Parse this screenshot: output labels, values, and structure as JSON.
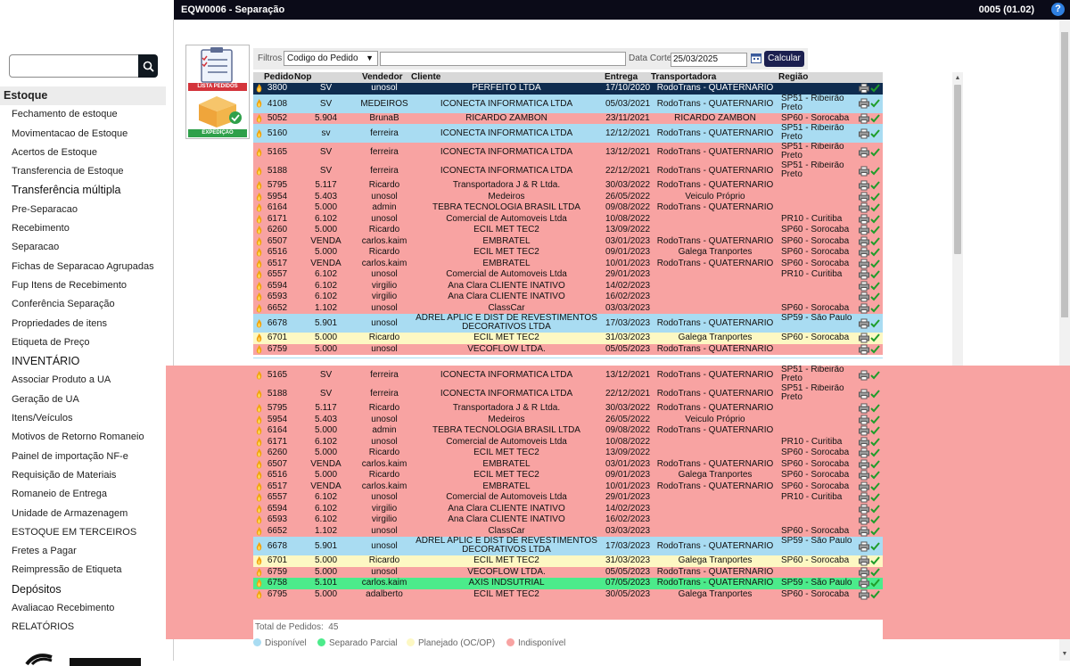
{
  "window": {
    "title": "EQW0006 - Separação",
    "version": "0005 (01.02)",
    "help_label": "?"
  },
  "sidebar": {
    "search_placeholder": "",
    "items": [
      {
        "label": "Estoque",
        "kind": "active"
      },
      {
        "label": "Fechamento de estoque",
        "kind": "item"
      },
      {
        "label": "Movimentacao de Estoque",
        "kind": "item"
      },
      {
        "label": "Acertos de Estoque",
        "kind": "item"
      },
      {
        "label": "Transferencia de Estoque",
        "kind": "item"
      },
      {
        "label": "Transferência múltipla",
        "kind": "section"
      },
      {
        "label": "Pre-Separacao",
        "kind": "item"
      },
      {
        "label": "Recebimento",
        "kind": "item"
      },
      {
        "label": "Separacao",
        "kind": "item"
      },
      {
        "label": "Fichas de Separacao Agrupadas",
        "kind": "item"
      },
      {
        "label": "Fup Itens de Recebimento",
        "kind": "item"
      },
      {
        "label": "Conferência Separação",
        "kind": "item"
      },
      {
        "label": "Propriedades de itens",
        "kind": "item"
      },
      {
        "label": "Etiqueta de Preço",
        "kind": "item"
      },
      {
        "label": "INVENTÁRIO",
        "kind": "section"
      },
      {
        "label": "Associar Produto a UA",
        "kind": "item"
      },
      {
        "label": "Geração de UA",
        "kind": "item"
      },
      {
        "label": "Itens/Veículos",
        "kind": "item"
      },
      {
        "label": "Motivos de Retorno Romaneio",
        "kind": "item"
      },
      {
        "label": "Painel de importação NF-e",
        "kind": "item"
      },
      {
        "label": "Requisição de Materiais",
        "kind": "item"
      },
      {
        "label": "Romaneio de Entrega",
        "kind": "item"
      },
      {
        "label": "Unidade de Armazenagem",
        "kind": "item"
      },
      {
        "label": "ESTOQUE EM TERCEIROS",
        "kind": "item"
      },
      {
        "label": "Fretes a Pagar",
        "kind": "item"
      },
      {
        "label": "Reimpressão de Etiqueta",
        "kind": "item"
      },
      {
        "label": "Depósitos",
        "kind": "section"
      },
      {
        "label": "Avaliacao Recebimento",
        "kind": "item"
      },
      {
        "label": "RELATÓRIOS",
        "kind": "item"
      }
    ]
  },
  "logo": {
    "top_band": "LISTA PEDIDOS",
    "bottom_band": "EXPEDIÇÃO"
  },
  "filters": {
    "label": "Filtros",
    "select_value": "Codigo do Pedido",
    "search_value": "",
    "date_label": "Data Corte",
    "date_value": "25/03/2025",
    "calc_label": "Calcular"
  },
  "grid": {
    "columns": [
      "Pedido",
      "Nop",
      "Vendedor",
      "Cliente",
      "Entrega",
      "Transportadora",
      "Região"
    ],
    "status_colors": {
      "blue": "#a9dcf2",
      "pink": "#f8a3a2",
      "yellow": "#fdf8c3",
      "green": "#4ceb8b",
      "selected": "#0f2c4f"
    },
    "rows": [
      {
        "pedido": "3800",
        "nop": "SV",
        "vendedor": "unosol",
        "cliente": "PERFEITO LTDA",
        "entrega": "17/10/2020",
        "transp": "RodoTrans - QUATERNARIO",
        "regiao": "",
        "status": "selected"
      },
      {
        "pedido": "4108",
        "nop": "SV",
        "vendedor": "MEDEIROS",
        "cliente": "ICONECTA INFORMATICA LTDA",
        "entrega": "05/03/2021",
        "transp": "RodoTrans - QUATERNARIO",
        "regiao": "SP51 - Ribeirão Preto",
        "status": "blue"
      },
      {
        "pedido": "5052",
        "nop": "5.904",
        "vendedor": "BrunaB",
        "cliente": "RICARDO ZAMBON",
        "entrega": "23/11/2021",
        "transp": "RICARDO ZAMBON",
        "regiao": "SP60 - Sorocaba",
        "status": "pink"
      },
      {
        "pedido": "5160",
        "nop": "sv",
        "vendedor": "ferreira",
        "cliente": "ICONECTA INFORMATICA LTDA",
        "entrega": "12/12/2021",
        "transp": "RodoTrans - QUATERNARIO",
        "regiao": "SP51 - Ribeirão Preto",
        "status": "blue"
      },
      {
        "pedido": "5165",
        "nop": "SV",
        "vendedor": "ferreira",
        "cliente": "ICONECTA INFORMATICA LTDA",
        "entrega": "13/12/2021",
        "transp": "RodoTrans - QUATERNARIO",
        "regiao": "SP51 - Ribeirão Preto",
        "status": "pink"
      },
      {
        "pedido": "5188",
        "nop": "SV",
        "vendedor": "ferreira",
        "cliente": "ICONECTA INFORMATICA LTDA",
        "entrega": "22/12/2021",
        "transp": "RodoTrans - QUATERNARIO",
        "regiao": "SP51 - Ribeirão Preto",
        "status": "pink"
      },
      {
        "pedido": "5795",
        "nop": "5.117",
        "vendedor": "Ricardo",
        "cliente": "Transportadora J & R Ltda.",
        "entrega": "30/03/2022",
        "transp": "RodoTrans - QUATERNARIO",
        "regiao": "",
        "status": "pink"
      },
      {
        "pedido": "5954",
        "nop": "5.403",
        "vendedor": "unosol",
        "cliente": "Medeiros",
        "entrega": "26/05/2022",
        "transp": "Veiculo Próprio",
        "regiao": "",
        "status": "pink"
      },
      {
        "pedido": "6164",
        "nop": "5.000",
        "vendedor": "admin",
        "cliente": "TEBRA TECNOLOGIA BRASIL LTDA",
        "entrega": "09/08/2022",
        "transp": "RodoTrans - QUATERNARIO",
        "regiao": "",
        "status": "pink"
      },
      {
        "pedido": "6171",
        "nop": "6.102",
        "vendedor": "unosol",
        "cliente": "Comercial de Automoveis Ltda",
        "entrega": "10/08/2022",
        "transp": "",
        "regiao": "PR10 - Curitiba",
        "status": "pink"
      },
      {
        "pedido": "6260",
        "nop": "5.000",
        "vendedor": "Ricardo",
        "cliente": "ECIL MET TEC2",
        "entrega": "13/09/2022",
        "transp": "",
        "regiao": "SP60 - Sorocaba",
        "status": "pink"
      },
      {
        "pedido": "6507",
        "nop": "VENDA",
        "vendedor": "carlos.kaim",
        "cliente": "EMBRATEL",
        "entrega": "03/01/2023",
        "transp": "RodoTrans - QUATERNARIO",
        "regiao": "SP60 - Sorocaba",
        "status": "pink"
      },
      {
        "pedido": "6516",
        "nop": "5.000",
        "vendedor": "Ricardo",
        "cliente": "ECIL MET TEC2",
        "entrega": "09/01/2023",
        "transp": "Galega Tranportes",
        "regiao": "SP60 - Sorocaba",
        "status": "pink"
      },
      {
        "pedido": "6517",
        "nop": "VENDA",
        "vendedor": "carlos.kaim",
        "cliente": "EMBRATEL",
        "entrega": "10/01/2023",
        "transp": "RodoTrans - QUATERNARIO",
        "regiao": "SP60 - Sorocaba",
        "status": "pink"
      },
      {
        "pedido": "6557",
        "nop": "6.102",
        "vendedor": "unosol",
        "cliente": "Comercial de Automoveis Ltda",
        "entrega": "29/01/2023",
        "transp": "",
        "regiao": "PR10 - Curitiba",
        "status": "pink"
      },
      {
        "pedido": "6594",
        "nop": "6.102",
        "vendedor": "virgilio",
        "cliente": "Ana Clara CLIENTE INATIVO",
        "entrega": "14/02/2023",
        "transp": "",
        "regiao": "",
        "status": "pink"
      },
      {
        "pedido": "6593",
        "nop": "6.102",
        "vendedor": "virgilio",
        "cliente": "Ana Clara CLIENTE INATIVO",
        "entrega": "16/02/2023",
        "transp": "",
        "regiao": "",
        "status": "pink"
      },
      {
        "pedido": "6652",
        "nop": "1.102",
        "vendedor": "unosol",
        "cliente": "ClassCar",
        "entrega": "03/03/2023",
        "transp": "",
        "regiao": "SP60 - Sorocaba",
        "status": "pink"
      },
      {
        "pedido": "6678",
        "nop": "5.901",
        "vendedor": "unosol",
        "cliente": "ADREL APLIC E DIST DE REVESTIMENTOS DECORATIVOS LTDA",
        "entrega": "17/03/2023",
        "transp": "RodoTrans - QUATERNARIO",
        "regiao": "SP59 - São Paulo",
        "status": "blue"
      },
      {
        "pedido": "6701",
        "nop": "5.000",
        "vendedor": "Ricardo",
        "cliente": "ECIL MET TEC2",
        "entrega": "31/03/2023",
        "transp": "Galega Tranportes",
        "regiao": "SP60 - Sorocaba",
        "status": "yellow"
      },
      {
        "pedido": "6759",
        "nop": "5.000",
        "vendedor": "unosol",
        "cliente": "VECOFLOW LTDA.",
        "entrega": "05/05/2023",
        "transp": "RodoTrans - QUATERNARIO",
        "regiao": "",
        "status": "pink"
      }
    ],
    "dup_row": {
      "pedido": "5160",
      "nop": "sv",
      "vendedor": "ferreira",
      "cliente": "ICONECTA INFORMATICA LTDA",
      "entrega": "12/12/2021",
      "transp": "RodoTrans - QUATERNARIO",
      "regiao": "Preto",
      "status": "blue"
    },
    "rows_b": [
      {
        "pedido": "5165",
        "nop": "SV",
        "vendedor": "ferreira",
        "cliente": "ICONECTA INFORMATICA LTDA",
        "entrega": "13/12/2021",
        "transp": "RodoTrans - QUATERNARIO",
        "regiao": "SP51 - Ribeirão Preto",
        "status": "pink"
      },
      {
        "pedido": "5188",
        "nop": "SV",
        "vendedor": "ferreira",
        "cliente": "ICONECTA INFORMATICA LTDA",
        "entrega": "22/12/2021",
        "transp": "RodoTrans - QUATERNARIO",
        "regiao": "SP51 - Ribeirão Preto",
        "status": "pink"
      },
      {
        "pedido": "5795",
        "nop": "5.117",
        "vendedor": "Ricardo",
        "cliente": "Transportadora J & R Ltda.",
        "entrega": "30/03/2022",
        "transp": "RodoTrans - QUATERNARIO",
        "regiao": "",
        "status": "pink"
      },
      {
        "pedido": "5954",
        "nop": "5.403",
        "vendedor": "unosol",
        "cliente": "Medeiros",
        "entrega": "26/05/2022",
        "transp": "Veiculo Próprio",
        "regiao": "",
        "status": "pink"
      },
      {
        "pedido": "6164",
        "nop": "5.000",
        "vendedor": "admin",
        "cliente": "TEBRA TECNOLOGIA BRASIL LTDA",
        "entrega": "09/08/2022",
        "transp": "RodoTrans - QUATERNARIO",
        "regiao": "",
        "status": "pink"
      },
      {
        "pedido": "6171",
        "nop": "6.102",
        "vendedor": "unosol",
        "cliente": "Comercial de Automoveis Ltda",
        "entrega": "10/08/2022",
        "transp": "",
        "regiao": "PR10 - Curitiba",
        "status": "pink"
      },
      {
        "pedido": "6260",
        "nop": "5.000",
        "vendedor": "Ricardo",
        "cliente": "ECIL MET TEC2",
        "entrega": "13/09/2022",
        "transp": "",
        "regiao": "SP60 - Sorocaba",
        "status": "pink"
      },
      {
        "pedido": "6507",
        "nop": "VENDA",
        "vendedor": "carlos.kaim",
        "cliente": "EMBRATEL",
        "entrega": "03/01/2023",
        "transp": "RodoTrans - QUATERNARIO",
        "regiao": "SP60 - Sorocaba",
        "status": "pink"
      },
      {
        "pedido": "6516",
        "nop": "5.000",
        "vendedor": "Ricardo",
        "cliente": "ECIL MET TEC2",
        "entrega": "09/01/2023",
        "transp": "Galega Tranportes",
        "regiao": "SP60 - Sorocaba",
        "status": "pink"
      },
      {
        "pedido": "6517",
        "nop": "VENDA",
        "vendedor": "carlos.kaim",
        "cliente": "EMBRATEL",
        "entrega": "10/01/2023",
        "transp": "RodoTrans - QUATERNARIO",
        "regiao": "SP60 - Sorocaba",
        "status": "pink"
      },
      {
        "pedido": "6557",
        "nop": "6.102",
        "vendedor": "unosol",
        "cliente": "Comercial de Automoveis Ltda",
        "entrega": "29/01/2023",
        "transp": "",
        "regiao": "PR10 - Curitiba",
        "status": "pink"
      },
      {
        "pedido": "6594",
        "nop": "6.102",
        "vendedor": "virgilio",
        "cliente": "Ana Clara CLIENTE INATIVO",
        "entrega": "14/02/2023",
        "transp": "",
        "regiao": "",
        "status": "pink"
      },
      {
        "pedido": "6593",
        "nop": "6.102",
        "vendedor": "virgilio",
        "cliente": "Ana Clara CLIENTE INATIVO",
        "entrega": "16/02/2023",
        "transp": "",
        "regiao": "",
        "status": "pink"
      },
      {
        "pedido": "6652",
        "nop": "1.102",
        "vendedor": "unosol",
        "cliente": "ClassCar",
        "entrega": "03/03/2023",
        "transp": "",
        "regiao": "SP60 - Sorocaba",
        "status": "pink"
      },
      {
        "pedido": "6678",
        "nop": "5.901",
        "vendedor": "unosol",
        "cliente": "ADREL APLIC E DIST DE REVESTIMENTOS DECORATIVOS LTDA",
        "entrega": "17/03/2023",
        "transp": "RodoTrans - QUATERNARIO",
        "regiao": "SP59 - São Paulo",
        "status": "blue"
      },
      {
        "pedido": "6701",
        "nop": "5.000",
        "vendedor": "Ricardo",
        "cliente": "ECIL MET TEC2",
        "entrega": "31/03/2023",
        "transp": "Galega Tranportes",
        "regiao": "SP60 - Sorocaba",
        "status": "yellow"
      },
      {
        "pedido": "6759",
        "nop": "5.000",
        "vendedor": "unosol",
        "cliente": "VECOFLOW LTDA.",
        "entrega": "05/05/2023",
        "transp": "RodoTrans - QUATERNARIO",
        "regiao": "",
        "status": "pink"
      },
      {
        "pedido": "6758",
        "nop": "5.101",
        "vendedor": "carlos.kaim",
        "cliente": "AXIS INDSUTRIAL",
        "entrega": "07/05/2023",
        "transp": "RodoTrans - QUATERNARIO",
        "regiao": "SP59 - São Paulo",
        "status": "green"
      },
      {
        "pedido": "6795",
        "nop": "5.000",
        "vendedor": "adalberto",
        "cliente": "ECIL MET TEC2",
        "entrega": "30/05/2023",
        "transp": "Galega Tranportes",
        "regiao": "SP60 - Sorocaba",
        "status": "pink"
      }
    ]
  },
  "footer": {
    "total_label": "Total de Pedidos:",
    "total_value": "45",
    "legend": [
      {
        "label": "Disponível",
        "color": "#a9dcf2"
      },
      {
        "label": "Separado Parcial",
        "color": "#4ceb8b"
      },
      {
        "label": "Planejado (OC/OP)",
        "color": "#fdf8c3"
      },
      {
        "label": "Indisponível",
        "color": "#f8a3a2"
      }
    ]
  }
}
